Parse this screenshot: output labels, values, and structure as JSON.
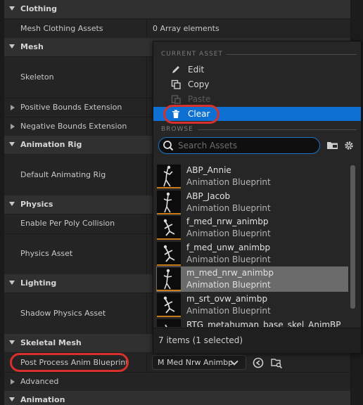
{
  "details": {
    "categories": {
      "clothing": "Clothing",
      "mesh": "Mesh",
      "animation_rig": "Animation Rig",
      "physics": "Physics",
      "lighting": "Lighting",
      "skeletal_mesh": "Skeletal Mesh",
      "animation": "Animation"
    },
    "rows": {
      "mesh_clothing_assets": "Mesh Clothing Assets",
      "mesh_clothing_assets_value": "0 Array elements",
      "skeleton": "Skeleton",
      "positive_bounds": "Positive Bounds Extension",
      "negative_bounds": "Negative Bounds Extension",
      "default_animating_rig": "Default Animating Rig",
      "enable_per_poly": "Enable Per Poly Collision",
      "physics_asset": "Physics Asset",
      "shadow_physics_asset": "Shadow Physics Asset",
      "post_process_anim_bp": "Post Process Anim Blueprint",
      "post_process_value": "M Med Nrw Animbp",
      "advanced": "Advanced"
    }
  },
  "popup": {
    "current_asset_header": "CURRENT ASSET",
    "browse_header": "BROWSE",
    "menu": [
      {
        "label": "Edit",
        "icon": "pencil-icon",
        "enabled": true
      },
      {
        "label": "Copy",
        "icon": "copy-icon",
        "enabled": true
      },
      {
        "label": "Paste",
        "icon": "paste-icon",
        "enabled": false
      },
      {
        "label": "Clear",
        "icon": "trash-icon",
        "enabled": true,
        "selected": true
      }
    ],
    "search_placeholder": "Search Assets",
    "assets": [
      {
        "name": "ABP_Annie",
        "type": "Animation Blueprint"
      },
      {
        "name": "ABP_Jacob",
        "type": "Animation Blueprint"
      },
      {
        "name": "f_med_nrw_animbp",
        "type": "Animation Blueprint"
      },
      {
        "name": "f_med_unw_animbp",
        "type": "Animation Blueprint"
      },
      {
        "name": "m_med_nrw_animbp",
        "type": "Animation Blueprint",
        "selected": true
      },
      {
        "name": "m_srt_ovw_animbp",
        "type": "Animation Blueprint"
      },
      {
        "name": "RTG_metahuman_base_skel_AnimBP",
        "type": ""
      }
    ],
    "footer": "7 items (1 selected)"
  },
  "colors": {
    "accent": "#0e70d2",
    "highlight_ring": "#d9302c",
    "thumb_bar": "#c97a1a"
  }
}
